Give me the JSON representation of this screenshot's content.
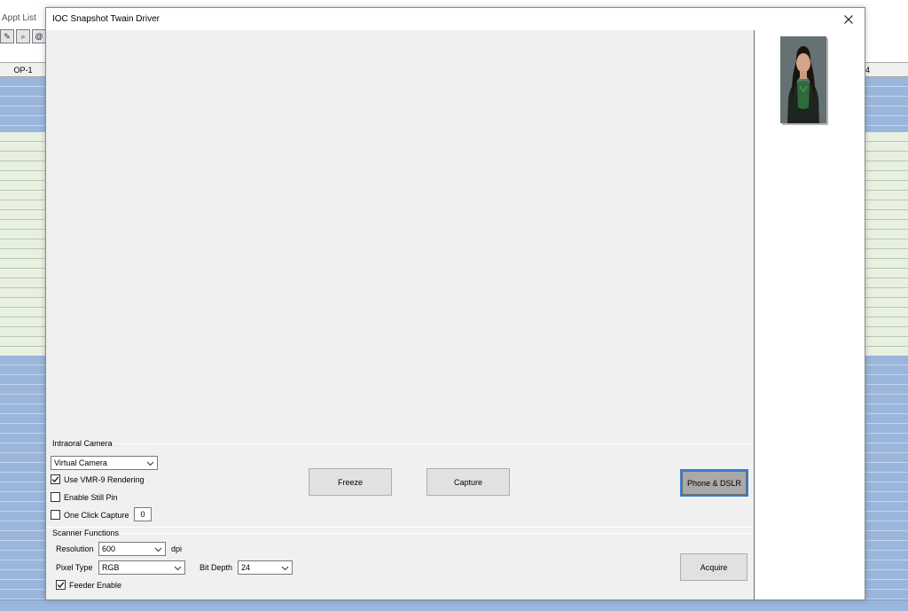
{
  "background_app": {
    "menu_item": "Appt List",
    "column_left": "OP-1",
    "column_right": "4",
    "toolbar_icons": [
      "edit-icon",
      "search-icon",
      "email-icon",
      "tool-icon"
    ],
    "colors": {
      "blue_band": "#9ab6dc",
      "green_band": "#e8f1e1"
    }
  },
  "window": {
    "title": "IOC Snapshot Twain Driver"
  },
  "intraoral_camera": {
    "group_label": "Intraoral Camera",
    "camera_select": "Virtual Camera",
    "use_vmr9": {
      "label": "Use VMR-9 Rendering",
      "checked": true
    },
    "enable_still_pin": {
      "label": "Enable Still Pin",
      "checked": false
    },
    "one_click_capture": {
      "label": "One Click Capture",
      "checked": false,
      "value": "0"
    },
    "freeze_label": "Freeze",
    "capture_label": "Capture",
    "phone_dslr_label": "Phone & DSLR"
  },
  "scanner_functions": {
    "group_label": "Scanner Functions",
    "resolution_label": "Resolution",
    "resolution_value": "600",
    "resolution_unit": "dpi",
    "pixel_type_label": "Pixel Type",
    "pixel_type_value": "RGB",
    "bit_depth_label": "Bit Depth",
    "bit_depth_value": "24",
    "feeder_enable": {
      "label": "Feeder Enable",
      "checked": true
    },
    "acquire_label": "Acquire"
  }
}
